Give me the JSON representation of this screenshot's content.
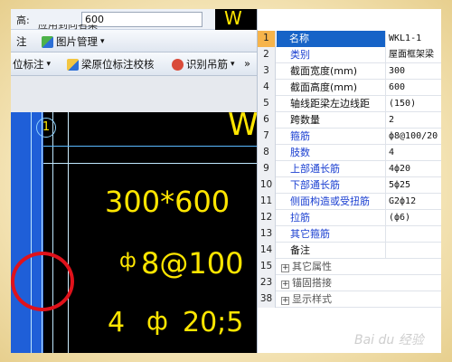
{
  "top_bar": {
    "label_partial": "高:",
    "input_value": "600",
    "partial_text": "应用到同名梁",
    "drawing_title": "W"
  },
  "toolbar1": {
    "item1_label": "注",
    "image_mgmt_label": "图片管理",
    "dropdown": "▾"
  },
  "toolbar2": {
    "mark_label": "位标注",
    "check_label": "梁原位标注校核",
    "identify_label": "识别吊筋",
    "more": "»",
    "dropdown": "▾"
  },
  "drawing": {
    "axis_number": "1",
    "wkl_title": "W",
    "section": "300*600",
    "stirrup": "8@100",
    "bar_count": "4",
    "bar_spec": "20;5"
  },
  "properties": {
    "rows": [
      {
        "num": "1",
        "name": "名称",
        "value": "WKL1-1"
      },
      {
        "num": "2",
        "name": "类别",
        "value": "屋面框架梁"
      },
      {
        "num": "3",
        "name": "截面宽度(mm)",
        "value": "300"
      },
      {
        "num": "4",
        "name": "截面高度(mm)",
        "value": "600"
      },
      {
        "num": "5",
        "name": "轴线距梁左边线距",
        "value": "(150)"
      },
      {
        "num": "6",
        "name": "跨数量",
        "value": "2"
      },
      {
        "num": "7",
        "name": "箍筋",
        "value": "ф8@100/20"
      },
      {
        "num": "8",
        "name": "肢数",
        "value": "4"
      },
      {
        "num": "9",
        "name": "上部通长筋",
        "value": "4ф20"
      },
      {
        "num": "10",
        "name": "下部通长筋",
        "value": "5ф25"
      },
      {
        "num": "11",
        "name": "侧面构造或受扭筋",
        "value": "G2ф12"
      },
      {
        "num": "12",
        "name": "拉筋",
        "value": "(ф6)"
      },
      {
        "num": "13",
        "name": "其它箍筋",
        "value": ""
      },
      {
        "num": "14",
        "name": "备注",
        "value": ""
      },
      {
        "num": "15",
        "name": "其它属性",
        "value": ""
      },
      {
        "num": "23",
        "name": "锚固搭接",
        "value": ""
      },
      {
        "num": "38",
        "name": "显示样式",
        "value": ""
      }
    ],
    "expand_symbol": "+"
  },
  "watermark": "Bai du 经验",
  "colors": {
    "selected_header": "#1663c7",
    "cad_text": "#ffe600",
    "blue_label": "#1a3fd1",
    "annotation": "#e0121b"
  }
}
